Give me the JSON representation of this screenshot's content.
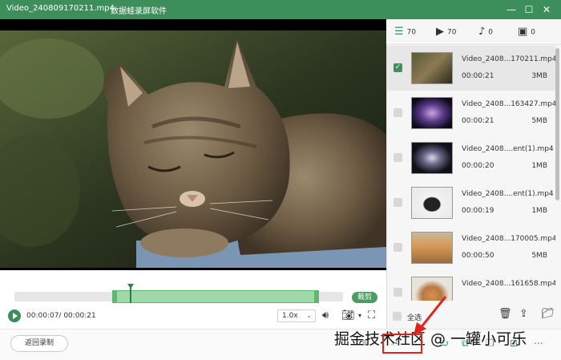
{
  "window": {
    "filename": "Video_240809170211.mp4",
    "app_name": "数据蛙录屏软件",
    "minimize": "—",
    "maximize": "☐",
    "close": "✕"
  },
  "tabs": [
    {
      "icon": "list-icon",
      "glyph": "☰",
      "count": "70"
    },
    {
      "icon": "video-icon",
      "glyph": "▶",
      "count": "70"
    },
    {
      "icon": "music-icon",
      "glyph": "♪",
      "count": "0"
    },
    {
      "icon": "image-icon",
      "glyph": "▣",
      "count": "0"
    }
  ],
  "recordings": [
    {
      "name": "Video_2408...170211.mp4",
      "duration": "00:00:21",
      "size": "3MB",
      "checked": true
    },
    {
      "name": "Video_2408...163427.mp4",
      "duration": "00:00:21",
      "size": "5MB",
      "checked": false
    },
    {
      "name": "Video_2408....ent(1).mp4",
      "duration": "00:00:20",
      "size": "1MB",
      "checked": false
    },
    {
      "name": "Video_2408....ent(1).mp4",
      "duration": "00:00:19",
      "size": "1MB",
      "checked": false
    },
    {
      "name": "Video_2408...170005.mp4",
      "duration": "00:00:50",
      "size": "5MB",
      "checked": false
    },
    {
      "name": "Video_2408...161658.mp4",
      "duration": "",
      "size": "",
      "checked": false
    }
  ],
  "player": {
    "time_display": "00:00:07/ 00:00:21",
    "speed": "1.0x",
    "cut_label": "裁剪",
    "playback_position": 0.333,
    "trim_start": 0.298,
    "trim_end": 0.927
  },
  "panel": {
    "select_all": "全选"
  },
  "bottom": {
    "back_label": "返回录制"
  },
  "watermark": "掘金技术社区 @ 一罐小可乐",
  "colors": {
    "brand": "#3c8f5a",
    "highlight": "#e2231a"
  }
}
